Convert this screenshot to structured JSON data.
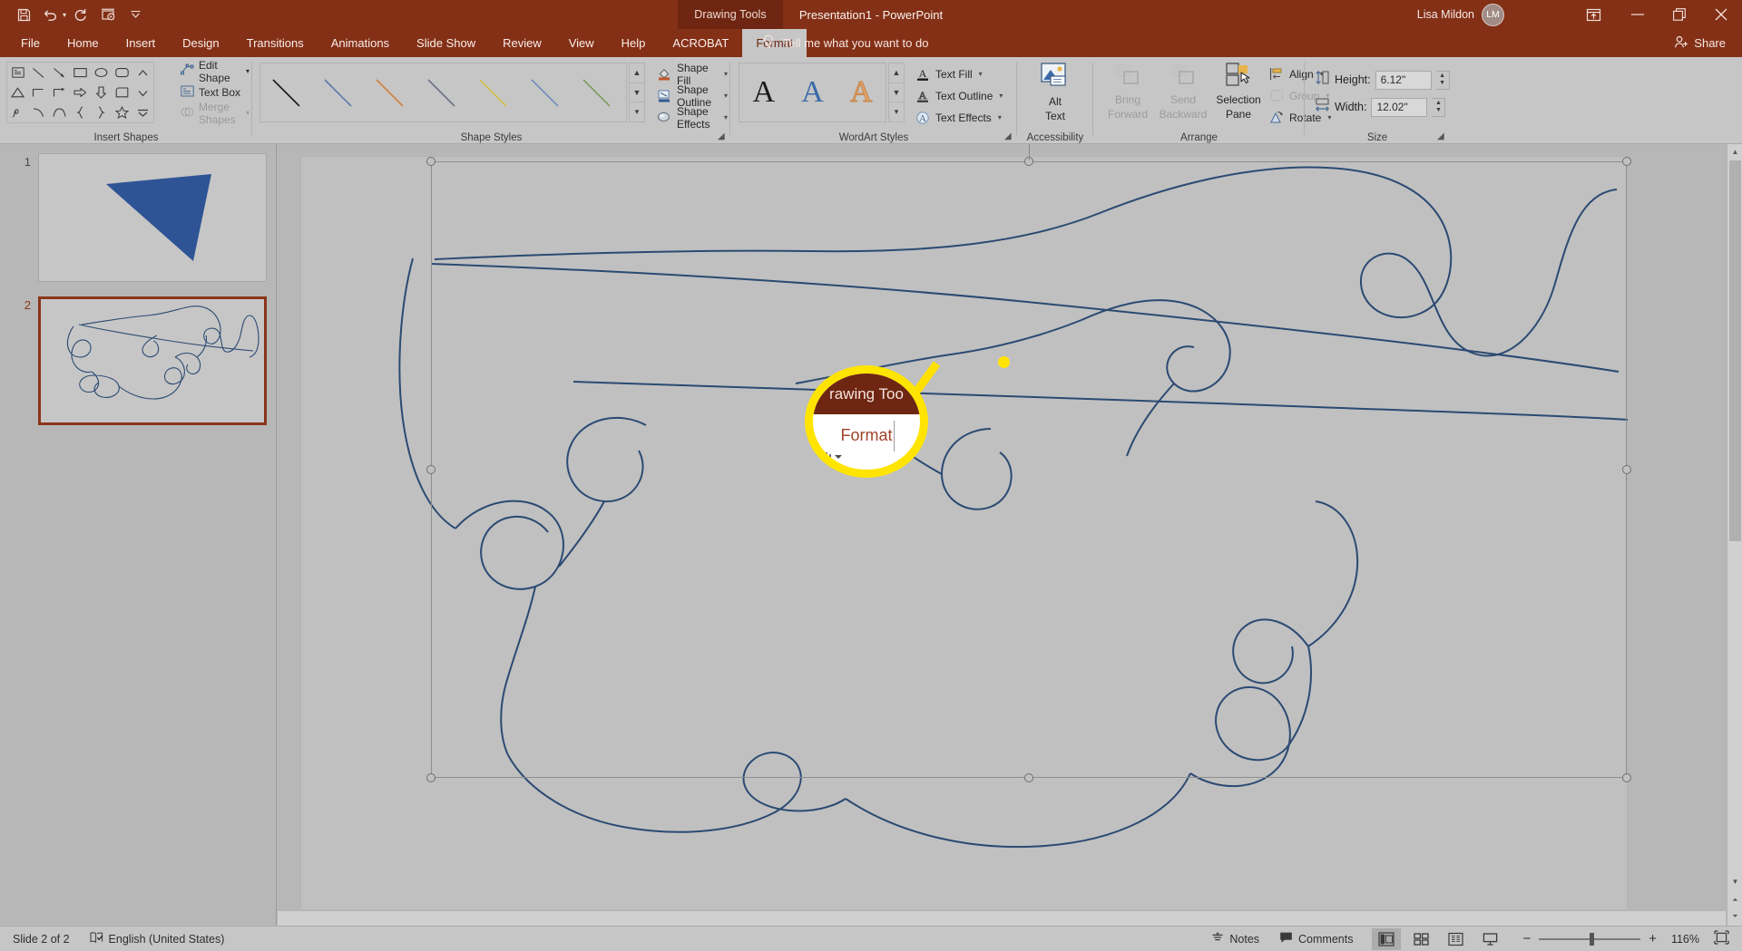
{
  "window": {
    "document_title": "Presentation1  -  PowerPoint",
    "contextual_tab_group": "Drawing Tools",
    "account_name": "Lisa Mildon",
    "account_initials": "LM",
    "accent_color": "#833017",
    "contextual_color": "#6e2612"
  },
  "quick_access": {
    "items": [
      {
        "name": "save-icon",
        "tooltip": "Save"
      },
      {
        "name": "undo-icon",
        "tooltip": "Undo"
      },
      {
        "name": "redo-icon",
        "tooltip": "Redo"
      },
      {
        "name": "start-from-beginning-icon",
        "tooltip": "Start From Beginning"
      },
      {
        "name": "customize-qat-icon",
        "tooltip": "Customize Quick Access Toolbar"
      }
    ]
  },
  "window_controls": {
    "ribbon_display_options": "Ribbon Display Options",
    "minimize": "Minimize",
    "restore": "Restore Down",
    "close": "Close"
  },
  "tabs": [
    {
      "label": "File",
      "active": false
    },
    {
      "label": "Home",
      "active": false
    },
    {
      "label": "Insert",
      "active": false
    },
    {
      "label": "Design",
      "active": false
    },
    {
      "label": "Transitions",
      "active": false
    },
    {
      "label": "Animations",
      "active": false
    },
    {
      "label": "Slide Show",
      "active": false
    },
    {
      "label": "Review",
      "active": false
    },
    {
      "label": "View",
      "active": false
    },
    {
      "label": "Help",
      "active": false
    },
    {
      "label": "ACROBAT",
      "active": false
    },
    {
      "label": "Format",
      "active": true
    }
  ],
  "tell_me": {
    "label": "Tell me what you want to do",
    "icon": "lightbulb-icon"
  },
  "share": {
    "label": "Share",
    "icon": "share-person-icon"
  },
  "ribbon": {
    "groups": [
      {
        "name": "insert-shapes",
        "label": "Insert Shapes",
        "commands": [
          {
            "label": "Edit Shape",
            "icon": "edit-shape-icon",
            "has_dropdown": true,
            "disabled": false
          },
          {
            "label": "Text Box",
            "icon": "text-box-icon",
            "has_dropdown": false,
            "disabled": false
          },
          {
            "label": "Merge Shapes",
            "icon": "merge-shapes-icon",
            "has_dropdown": true,
            "disabled": true
          }
        ]
      },
      {
        "name": "shape-styles",
        "label": "Shape Styles",
        "gallery_item_colors": [
          "#1a1a1a",
          "#5b7ca6",
          "#d0803e",
          "#6a7480",
          "#d8bf49",
          "#6f8fba",
          "#7fa05a"
        ],
        "commands": [
          {
            "label": "Shape Fill",
            "icon": "shape-fill-icon",
            "has_dropdown": true
          },
          {
            "label": "Shape Outline",
            "icon": "shape-outline-icon",
            "has_dropdown": true
          },
          {
            "label": "Shape Effects",
            "icon": "shape-effects-icon",
            "has_dropdown": true
          }
        ]
      },
      {
        "name": "wordart-styles",
        "label": "WordArt Styles",
        "gallery_letters": [
          {
            "glyph": "A",
            "color": "#1c1c1c"
          },
          {
            "glyph": "A",
            "color": "#3a6aa8"
          },
          {
            "glyph": "A",
            "color": "#e0a36a"
          }
        ],
        "commands": [
          {
            "label": "Text Fill",
            "icon": "text-fill-icon",
            "has_dropdown": true
          },
          {
            "label": "Text Outline",
            "icon": "text-outline-icon",
            "has_dropdown": true
          },
          {
            "label": "Text Effects",
            "icon": "text-effects-icon",
            "has_dropdown": true
          }
        ]
      },
      {
        "name": "accessibility",
        "label": "Accessibility",
        "buttons": [
          {
            "label_line1": "Alt",
            "label_line2": "Text",
            "icon": "alt-text-icon",
            "disabled": false
          }
        ]
      },
      {
        "name": "arrange",
        "label": "Arrange",
        "buttons": [
          {
            "label_line1": "Bring",
            "label_line2": "Forward",
            "icon": "bring-forward-icon",
            "disabled": true,
            "has_dropdown": true
          },
          {
            "label_line1": "Send",
            "label_line2": "Backward",
            "icon": "send-backward-icon",
            "disabled": true,
            "has_dropdown": true
          },
          {
            "label_line1": "Selection",
            "label_line2": "Pane",
            "icon": "selection-pane-icon",
            "disabled": false,
            "has_dropdown": false
          }
        ],
        "commands": [
          {
            "label": "Align",
            "icon": "align-icon",
            "has_dropdown": true,
            "disabled": false
          },
          {
            "label": "Group",
            "icon": "group-icon",
            "has_dropdown": true,
            "disabled": true
          },
          {
            "label": "Rotate",
            "icon": "rotate-icon",
            "has_dropdown": true,
            "disabled": false
          }
        ]
      },
      {
        "name": "size",
        "label": "Size",
        "fields": [
          {
            "label": "Height:",
            "value": "6.12\"",
            "icon": "shape-height-icon"
          },
          {
            "label": "Width:",
            "value": "12.02\"",
            "icon": "shape-width-icon"
          }
        ]
      }
    ]
  },
  "slides_pane": {
    "slides": [
      {
        "number": "1",
        "selected": false,
        "content": "blue-polygon-shape"
      },
      {
        "number": "2",
        "selected": true,
        "content": "navy-scribble-freeform"
      }
    ]
  },
  "canvas": {
    "selected_shape": "freeform-scribble",
    "shape_stroke_color": "#2b4a72",
    "handles_visible": true,
    "rotation_handle": "rotate-handle"
  },
  "callout": {
    "highlight_color": "#ffe400",
    "magnified_tab_group": "rawing Too",
    "magnified_tab_label": "Format"
  },
  "status_bar": {
    "slide_indicator": "Slide 2 of 2",
    "language": "English (United States)",
    "notes_label": "Notes",
    "comments_label": "Comments",
    "views": [
      {
        "name": "normal-view",
        "active": true
      },
      {
        "name": "slide-sorter-view",
        "active": false
      },
      {
        "name": "reading-view",
        "active": false
      },
      {
        "name": "slide-show-view",
        "active": false
      }
    ],
    "zoom_out": "−",
    "zoom_in": "+",
    "zoom_level": "116%",
    "fit_to_window": "fit-slide-icon"
  }
}
